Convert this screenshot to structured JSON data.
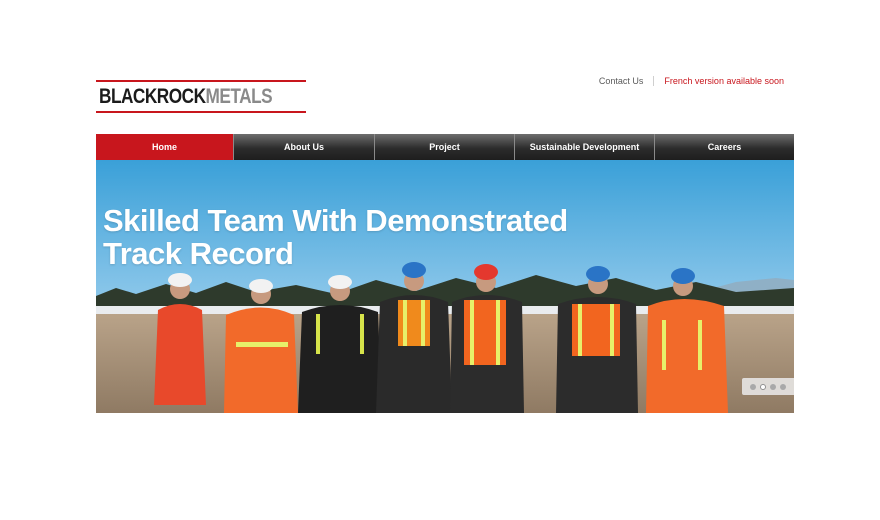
{
  "brand": {
    "name_black": "BLACKROCK",
    "name_metals": "METALS",
    "accent_color": "#c8161d"
  },
  "top_links": {
    "contact": "Contact Us",
    "french": "French version available soon"
  },
  "nav": {
    "items": [
      {
        "label": "Home",
        "active": true
      },
      {
        "label": "About Us",
        "active": false
      },
      {
        "label": "Project",
        "active": false
      },
      {
        "label": "Sustainable Development",
        "active": false
      },
      {
        "label": "Careers",
        "active": false
      }
    ]
  },
  "hero": {
    "title_line1": "Skilled Team With Demonstrated",
    "title_line2": "Track Record",
    "slide_count": 4,
    "active_slide": 2
  }
}
